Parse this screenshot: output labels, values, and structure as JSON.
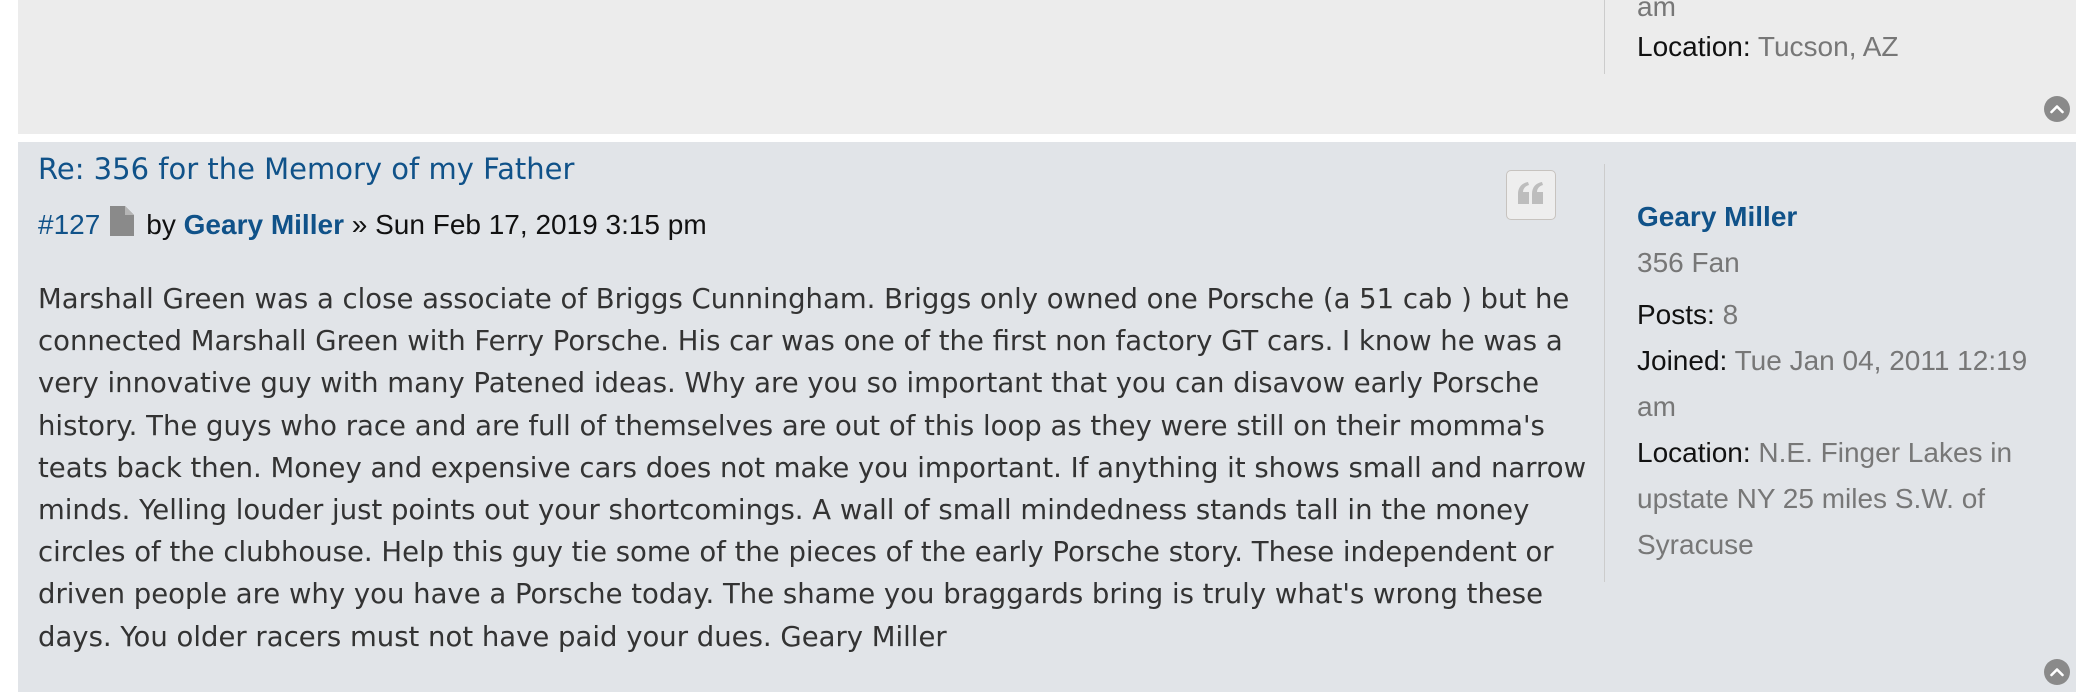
{
  "previous_post": {
    "profile": {
      "joined_tail": "am",
      "location_label": "Location:",
      "location_value": "Tucson, AZ"
    }
  },
  "post": {
    "title": "Re: 356 for the Memory of my Father",
    "number": "#127",
    "by": "by",
    "author": "Geary Miller",
    "separator": "»",
    "date": "Sun Feb 17, 2019 3:15 pm",
    "content_lines": [
      "Marshall Green was a close associate of Briggs Cunningham. Briggs only owned one Porsche (a 51 cab ) but he",
      "connected Marshall Green with Ferry Porsche. His car was one of the first non factory GT cars. I know he was a",
      "very innovative guy with many Patened ideas. Why are you so important that you can disavow early Porsche",
      "history. The guys who race and are full of themselves are out of this loop as they were still on their momma's",
      "teats back then. Money and expensive cars does not make you important. If anything it shows small and narrow",
      "minds. Yelling louder just points out your shortcomings. A wall of small mindedness stands tall in the money",
      "circles of the clubhouse. Help this guy tie some of the pieces of the early Porsche story. These independent or",
      "driven people are why you have a Porsche today. The shame you braggards bring is truly what's wrong these",
      "days. You older racers must not have paid your dues. Geary Miller"
    ],
    "profile": {
      "username": "Geary Miller",
      "rank": "356 Fan",
      "posts_label": "Posts:",
      "posts_value": "8",
      "joined_label": "Joined:",
      "joined_value_line1": "Tue Jan 04, 2011 12:19",
      "joined_value_line2": "am",
      "location_label": "Location:",
      "location_line1": "N.E. Finger Lakes in",
      "location_line2": "upstate NY 25 miles S.W. of",
      "location_line3": "Syracuse"
    }
  },
  "icons": {
    "quote": "quote-icon",
    "file": "file-icon",
    "back_to_top": "chevron-up-circle-icon"
  },
  "colors": {
    "link": "#105289",
    "post_bg": "#e1e4e8",
    "prev_post_bg": "#ececec",
    "muted_text": "#777777"
  }
}
